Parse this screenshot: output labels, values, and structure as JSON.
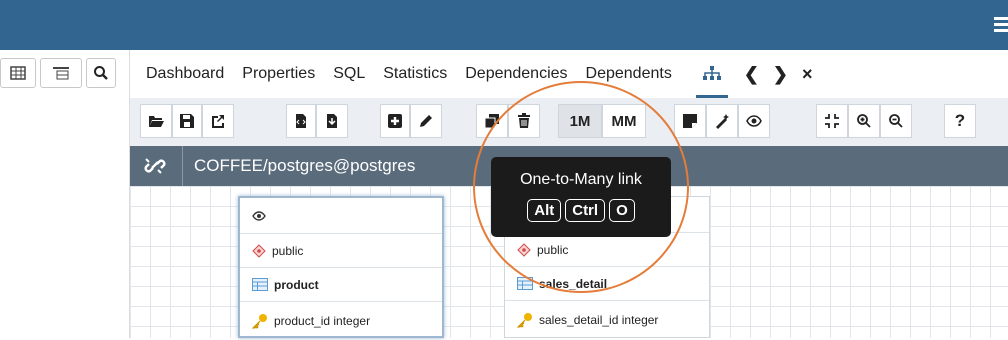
{
  "tabs": {
    "items": [
      "Dashboard",
      "Properties",
      "SQL",
      "Statistics",
      "Dependencies",
      "Dependents"
    ],
    "prev_glyph": "❮",
    "next_glyph": "❯",
    "more_glyph": "×"
  },
  "toolbar": {
    "one_to_many_label": "1M",
    "many_to_many_label": "MM",
    "help_label": "?"
  },
  "title": {
    "connection": "COFFEE/postgres@postgres"
  },
  "tooltip": {
    "title": "One-to-Many link",
    "keys": [
      "Alt",
      "Ctrl",
      "O"
    ]
  },
  "tables": [
    {
      "schema": "public",
      "name": "product",
      "column": "product_id integer"
    },
    {
      "schema": "public",
      "name": "sales_detail",
      "column": "sales_detail_id integer"
    }
  ],
  "colors": {
    "header": "#326690",
    "title_bar": "#5a6b7b",
    "highlight_circle": "#e47d3a",
    "tooltip_bg": "#1b1b1b"
  }
}
